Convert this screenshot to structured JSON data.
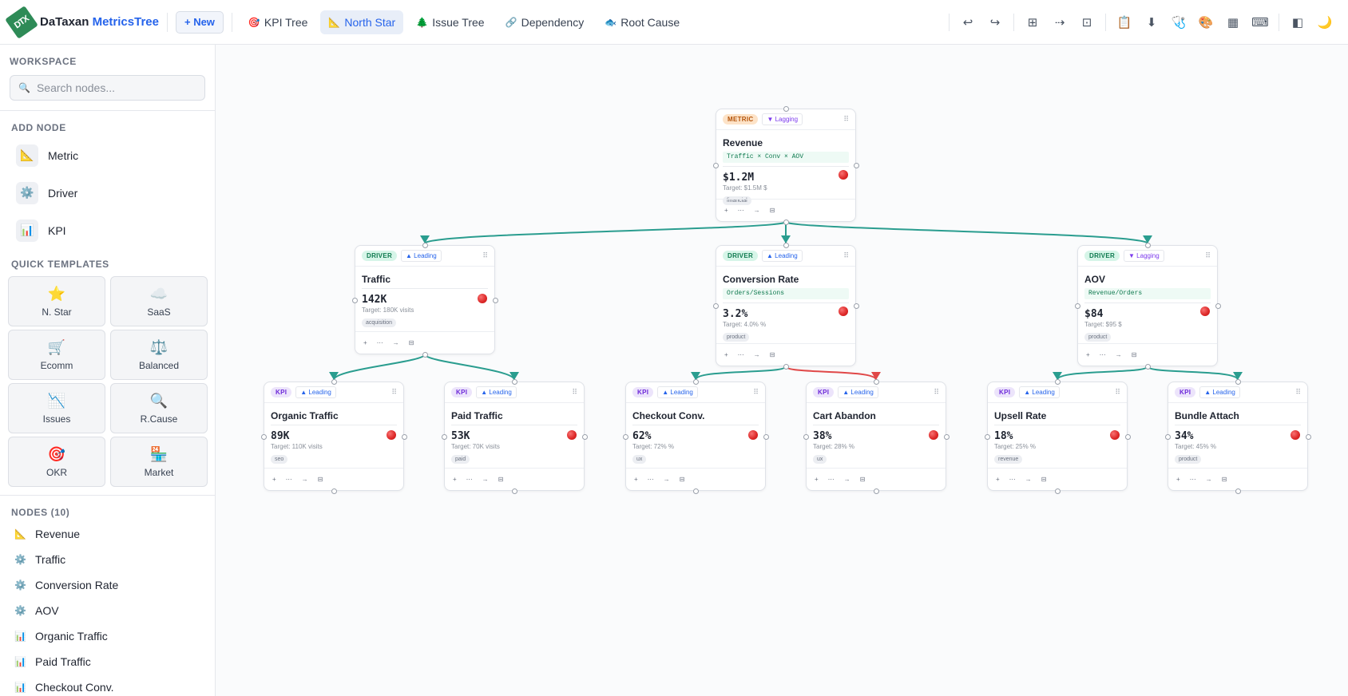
{
  "app": {
    "logo": "DTX",
    "brand": "DaTaxan",
    "brand_accent": "MetricsTree",
    "new_label": "+ New"
  },
  "tabs": [
    {
      "label": "KPI Tree",
      "icon": "🎯"
    },
    {
      "label": "North Star",
      "icon": "📐"
    },
    {
      "label": "Issue Tree",
      "icon": "🌲"
    },
    {
      "label": "Dependency",
      "icon": "🔗"
    },
    {
      "label": "Root Cause",
      "icon": "🐟"
    }
  ],
  "toolbar_icons": [
    "undo-icon",
    "redo-icon",
    "grid-icon",
    "arrow-right-icon",
    "frame-icon",
    "clipboard-icon",
    "download-icon",
    "stethoscope-icon",
    "palette-icon",
    "table-icon",
    "keyboard-icon",
    "panel-icon",
    "moon-icon"
  ],
  "sidebar": {
    "workspace_title": "Workspace",
    "search_placeholder": "Search nodes...",
    "add_node_title": "Add Node",
    "add_nodes": [
      {
        "label": "Metric",
        "icon": "📐"
      },
      {
        "label": "Driver",
        "icon": "⚙️"
      },
      {
        "label": "KPI",
        "icon": "📊"
      }
    ],
    "templates_title": "Quick Templates",
    "templates": [
      {
        "label": "N. Star",
        "icon": "⭐"
      },
      {
        "label": "SaaS",
        "icon": "☁️"
      },
      {
        "label": "Ecomm",
        "icon": "🛒"
      },
      {
        "label": "Balanced",
        "icon": "⚖️"
      },
      {
        "label": "Issues",
        "icon": "📉"
      },
      {
        "label": "R.Cause",
        "icon": "🔍"
      },
      {
        "label": "OKR",
        "icon": "🎯"
      },
      {
        "label": "Market",
        "icon": "🏪"
      }
    ],
    "nodes_title": "Nodes (10)",
    "nodes": [
      {
        "label": "Revenue",
        "icon": "📐"
      },
      {
        "label": "Traffic",
        "icon": "⚙️"
      },
      {
        "label": "Conversion Rate",
        "icon": "⚙️"
      },
      {
        "label": "AOV",
        "icon": "⚙️"
      },
      {
        "label": "Organic Traffic",
        "icon": "📊"
      },
      {
        "label": "Paid Traffic",
        "icon": "📊"
      },
      {
        "label": "Checkout Conv.",
        "icon": "📊"
      }
    ]
  },
  "card_footer": [
    "+",
    "⋯",
    "→",
    "⊟"
  ],
  "colors": {
    "edge_ok": "#2a9d8f",
    "edge_bad": "#e04848",
    "status_red": "#dc2626"
  },
  "cards": [
    {
      "id": "revenue",
      "type": "Metric",
      "dir": "▼ Lagging",
      "lag": true,
      "title": "Revenue",
      "formula": "Traffic × Conv × AOV",
      "value": "$1.2M",
      "target": "Target: $1.5M $",
      "tag": "financial"
    },
    {
      "id": "traffic",
      "type": "Driver",
      "dir": "▲ Leading",
      "lag": false,
      "title": "Traffic",
      "formula": "",
      "value": "142K",
      "target": "Target: 180K visits",
      "tag": "acquisition"
    },
    {
      "id": "conversion-rate",
      "type": "Driver",
      "dir": "▲ Leading",
      "lag": false,
      "title": "Conversion Rate",
      "formula": "Orders/Sessions",
      "value": "3.2%",
      "target": "Target: 4.0% %",
      "tag": "product"
    },
    {
      "id": "aov",
      "type": "Driver",
      "dir": "▼ Lagging",
      "lag": true,
      "title": "AOV",
      "formula": "Revenue/Orders",
      "value": "$84",
      "target": "Target: $95 $",
      "tag": "product"
    },
    {
      "id": "organic-traffic",
      "type": "KPI",
      "dir": "▲ Leading",
      "lag": false,
      "title": "Organic Traffic",
      "formula": "",
      "value": "89K",
      "target": "Target: 110K visits",
      "tag": "seo"
    },
    {
      "id": "paid-traffic",
      "type": "KPI",
      "dir": "▲ Leading",
      "lag": false,
      "title": "Paid Traffic",
      "formula": "",
      "value": "53K",
      "target": "Target: 70K visits",
      "tag": "paid"
    },
    {
      "id": "checkout-conv",
      "type": "KPI",
      "dir": "▲ Leading",
      "lag": false,
      "title": "Checkout Conv.",
      "formula": "",
      "value": "62%",
      "target": "Target: 72% %",
      "tag": "ux"
    },
    {
      "id": "cart-abandon",
      "type": "KPI",
      "dir": "▲ Leading",
      "lag": false,
      "title": "Cart Abandon",
      "formula": "",
      "value": "38%",
      "target": "Target: 28% %",
      "tag": "ux"
    },
    {
      "id": "upsell-rate",
      "type": "KPI",
      "dir": "▲ Leading",
      "lag": false,
      "title": "Upsell Rate",
      "formula": "",
      "value": "18%",
      "target": "Target: 25% %",
      "tag": "revenue"
    },
    {
      "id": "bundle-attach",
      "type": "KPI",
      "dir": "▲ Leading",
      "lag": false,
      "title": "Bundle Attach",
      "formula": "",
      "value": "34%",
      "target": "Target: 45% %",
      "tag": "product"
    }
  ]
}
